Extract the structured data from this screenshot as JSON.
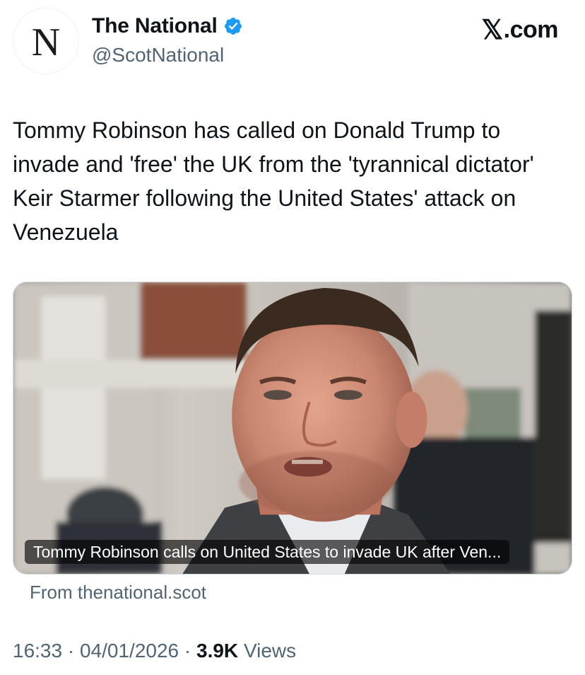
{
  "account": {
    "display_name": "The National",
    "handle": "@ScotNational",
    "avatar_letter": "N",
    "verified": true,
    "verified_color": "#1d9bf0",
    "verified_icon": "verified-badge-icon"
  },
  "source_site": {
    "x_glyph": "𝕏",
    "label": ".com"
  },
  "tweet": {
    "text": "Tommy Robinson has called on Donald Trump to invade and 'free' the UK from the 'tyrannical dictator' Keir Starmer following the United States' attack on Venezuela"
  },
  "link_card": {
    "caption": "Tommy Robinson calls on United States to invade UK after Ven...",
    "from_label": "From thenational.scot"
  },
  "meta": {
    "time": "16:33",
    "separator": "·",
    "date": "04/01/2026",
    "views_count": "3.9K",
    "views_label": "Views"
  },
  "colors": {
    "text_primary": "#0f1419",
    "text_secondary": "#536471",
    "border": "#cfd9de"
  }
}
